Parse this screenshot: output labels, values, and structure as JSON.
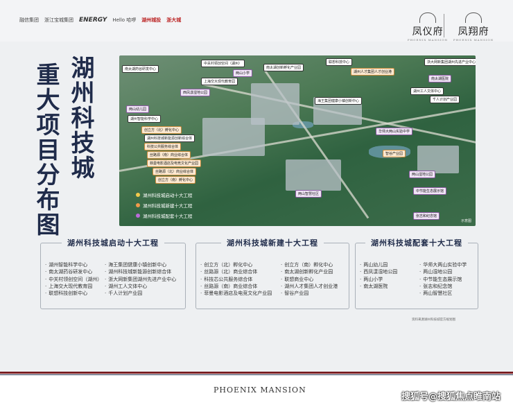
{
  "header": {
    "partners": [
      "融信集团",
      "浙江宝城集团",
      "ENERGY",
      "Hello 哈啰",
      "湖州城投",
      "浙大城"
    ],
    "brands": [
      {
        "name": "凤仪府",
        "sub": "PHOENIX MANSION"
      },
      {
        "name": "凤翔府",
        "sub": "PHOENIX MANSION"
      }
    ]
  },
  "title": {
    "line1": "湖州科技城",
    "line2": "重大项目分布图"
  },
  "map": {
    "labels": [
      {
        "text": "南太湖药谷研发中心",
        "type": "t1"
      },
      {
        "text": "中关村领创空间（湖州）",
        "type": "t1"
      },
      {
        "text": "南太湖创新孵化产业园",
        "type": "t1"
      },
      {
        "text": "联想科技中心",
        "type": "t1"
      },
      {
        "text": "两山小学",
        "type": "t3"
      },
      {
        "text": "上海交大现代教育园",
        "type": "t1"
      },
      {
        "text": "湖州人才集团人才创业港",
        "type": "t2"
      },
      {
        "text": "浙大网新集团湖州先进产业中心",
        "type": "t1"
      },
      {
        "text": "南太湖医院",
        "type": "t3"
      },
      {
        "text": "西凤漾湿地公园",
        "type": "t3"
      },
      {
        "text": "湖州工人文体中心",
        "type": "t1"
      },
      {
        "text": "千人计划产业园",
        "type": "t1"
      },
      {
        "text": "两山幼儿园",
        "type": "t3"
      },
      {
        "text": "湖州智能科学中心",
        "type": "t1"
      },
      {
        "text": "海王集团健康小镇创新中心",
        "type": "t1"
      },
      {
        "text": "创立方（北）孵化中心",
        "type": "t2"
      },
      {
        "text": "湖州科技城新能源创新综合体",
        "type": "t1"
      },
      {
        "text": "科技公共服务综合体",
        "type": "t2"
      },
      {
        "text": "丝路源（南）商业综合体",
        "type": "t2"
      },
      {
        "text": "菲曼电影酒店及电竞文化产业园",
        "type": "t2"
      },
      {
        "text": "丝路源（北）商业综合体",
        "type": "t2"
      },
      {
        "text": "创立方（南）孵化中心",
        "type": "t2"
      },
      {
        "text": "华师大两山实验中学",
        "type": "t3"
      },
      {
        "text": "智谷产业园",
        "type": "t2"
      },
      {
        "text": "两山智慧社区",
        "type": "t3"
      },
      {
        "text": "两山湿地公园",
        "type": "t3"
      },
      {
        "text": "中节能生态展示馆",
        "type": "t3"
      },
      {
        "text": "张志和纪念馆",
        "type": "t3"
      }
    ],
    "legend": [
      {
        "text": "湖州科技城启动十大工程",
        "color": "#f2c94c"
      },
      {
        "text": "湖州科技城新建十大工程",
        "color": "#f2994a"
      },
      {
        "text": "湖州科技城配套十大工程",
        "color": "#bb6bd9"
      }
    ],
    "note": "示意图"
  },
  "lists": [
    {
      "title": "湖州科技城启动十大工程",
      "col1": [
        "湖州智能科学中心",
        "南太湖药谷研发中心",
        "中关村领创空间（湖州）",
        "上海交大现代教育园",
        "联想科技创新中心"
      ],
      "col2": [
        "海王集团健康小镇创新中心",
        "湖州科技城新能源创新综合体",
        "浙大网新集团湖州先进产业中心",
        "湖州工人文体中心",
        "千人计划产业园"
      ]
    },
    {
      "title": "湖州科技城新建十大工程",
      "col1": [
        "创立方（北）孵化中心",
        "丝路源（北）商业综合体",
        "科技芯公共服务综合体",
        "丝路源（南）商业综合体",
        "菲曼电影酒店及电竞文化产业园"
      ],
      "col2": [
        "创立方（南）孵化中心",
        "南太湖创新孵化产业园",
        "联想商业中心",
        "湖州人才集团人才创业港",
        "智谷产业园"
      ]
    },
    {
      "title": "湖州科技城配套十大工程",
      "col1": [
        "两山幼儿园",
        "西凤漾湿地公园",
        "两山小学",
        "南太湖医院"
      ],
      "col2": [
        "华师大两山实验中学",
        "两山湿地公园",
        "中节能生态展示馆",
        "张志和纪念馆",
        "两山智慧社区"
      ]
    }
  ],
  "footnote": "资料来源湖州科技城官方规划图",
  "footer": {
    "brand": "PHOENIX MANSION",
    "watermark": "搜狐号@搜狐焦点睢南站"
  }
}
